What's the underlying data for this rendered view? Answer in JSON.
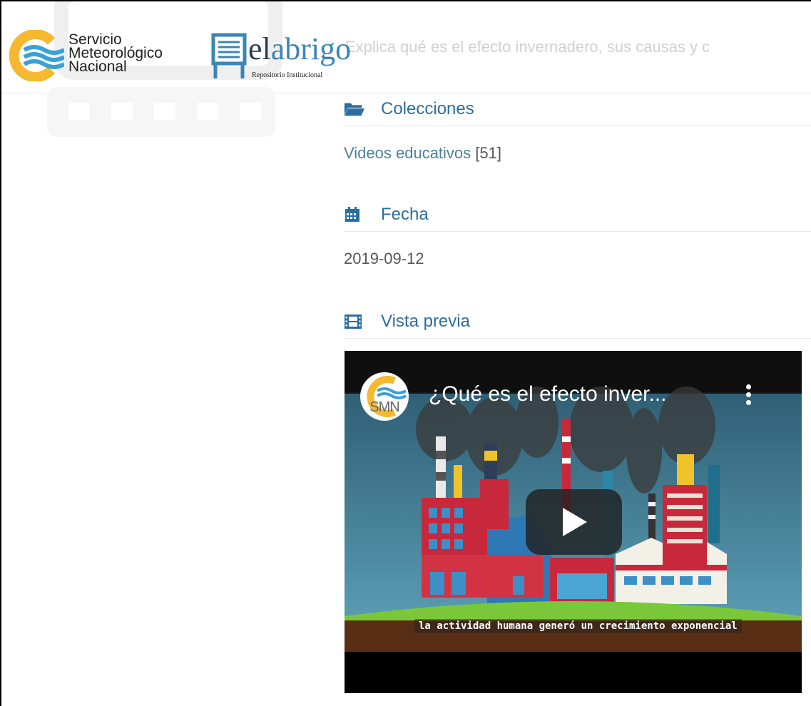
{
  "header": {
    "smn_lines": [
      "Servicio",
      "Meteorológico",
      "Nacional"
    ],
    "repo_name_el": "el",
    "repo_name_abrigo": "abrigo",
    "repo_subtitle": "Repositorio Institucional",
    "search_placeholder": "Explica qué es el efecto invernadero, sus causas y c"
  },
  "sections": {
    "collections": {
      "title": "Colecciones",
      "link": "Videos educativos",
      "count": "[51]"
    },
    "date": {
      "title": "Fecha",
      "value": "2019-09-12"
    },
    "preview": {
      "title": "Vista previa"
    }
  },
  "video": {
    "channel_logo_text": "SMN",
    "title": "¿Qué es el efecto inver...",
    "caption": "la actividad humana generó un crecimiento exponencial"
  },
  "colors": {
    "accent_blue": "#2c6e9e",
    "smn_yellow": "#f5b82e",
    "smn_blue": "#3aa0d8"
  }
}
